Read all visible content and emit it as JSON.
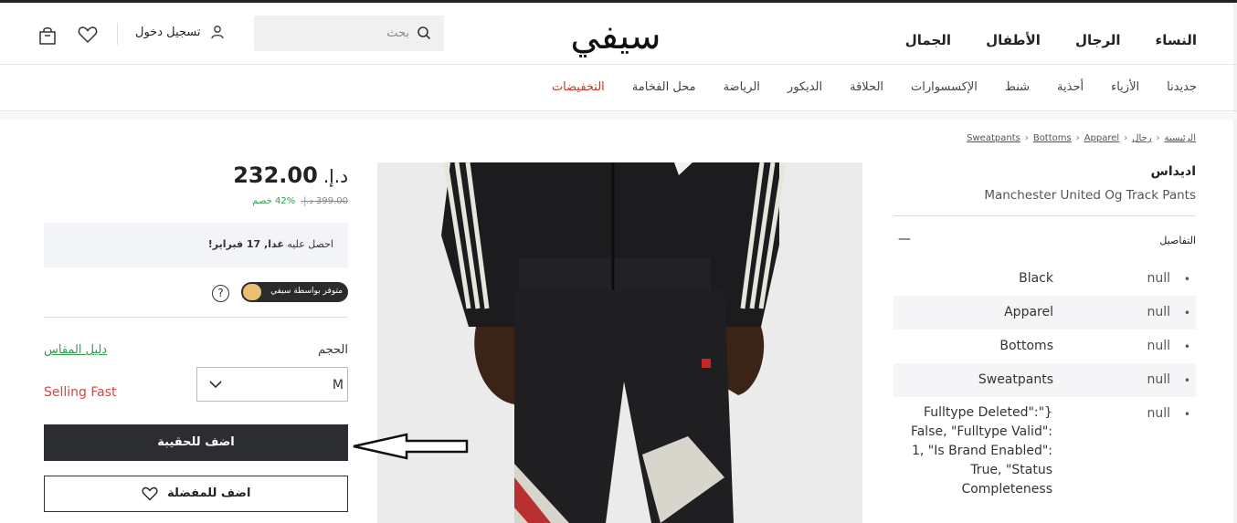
{
  "header": {
    "nav": [
      "النساء",
      "الرجال",
      "الأطفال",
      "الجمال"
    ],
    "logo_text": "سيفي",
    "search_placeholder": "بحث",
    "login_label": "تسجيل دخول"
  },
  "subnav": {
    "items": [
      "جديدنا",
      "الأزياء",
      "أحذية",
      "شنط",
      "الإكسسوارات",
      "الحلاقة",
      "الديكور",
      "الرياضة",
      "محل الفخامة",
      "التخفيضات"
    ]
  },
  "breadcrumb": [
    "الرئيسية",
    "رجال",
    "Apparel",
    "Bottoms",
    "Sweatpants"
  ],
  "product": {
    "brand": "اديداس",
    "name": "Manchester United Og Track Pants",
    "details_title": "التفاصيل",
    "details_toggle": "—",
    "specs": [
      {
        "key": "null",
        "value": "Black"
      },
      {
        "key": "null",
        "value": "Apparel"
      },
      {
        "key": "null",
        "value": "Bottoms"
      },
      {
        "key": "null",
        "value": "Sweatpants"
      }
    ],
    "long_spec_key": "null",
    "long_spec_value": "Fulltype Deleted\":\"} False, \"Fulltype Valid\": 1, \"Is Brand Enabled\": True, \"Status Completeness"
  },
  "buy": {
    "currency": "د.إ.",
    "price": "232.00",
    "old_price": "399.00 د.إ.",
    "discount": "42% خصم",
    "delivery_prefix": "احصل عليه",
    "delivery_bold": "غدا, 17 فبراير!",
    "fulfilled_label": "متوفر بواسطة سيفي",
    "help_symbol": "?",
    "size_label": "الحجم",
    "size_guide": "دليل المقاس",
    "size_value": "M",
    "selling_fast": "Selling Fast",
    "add_to_bag": "اضف للحقيبة",
    "add_to_wishlist": "اضف للمفضلة"
  },
  "colors": {
    "sale": "#c0392b",
    "discount": "#2e9e4e",
    "selling_fast": "#d9443b",
    "primary_button": "#2b2d31"
  }
}
